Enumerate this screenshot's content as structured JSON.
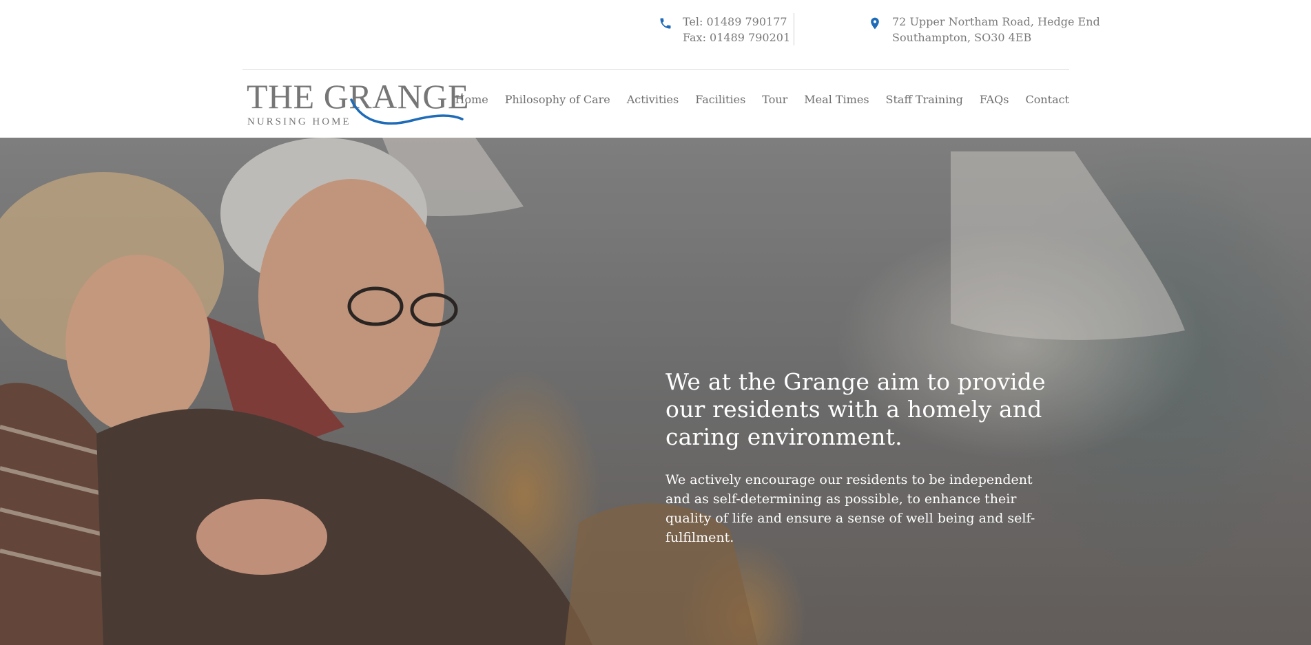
{
  "contact": {
    "phone_icon": "phone-icon",
    "tel": "Tel: 01489 790177",
    "fax": "Fax: 01489 790201",
    "location_icon": "map-marker-icon",
    "address_line1": "72 Upper Northam Road, Hedge End",
    "address_line2": "Southampton, SO30 4EB"
  },
  "logo": {
    "title": "THE GRANGE",
    "subtitle": "NURSING HOME"
  },
  "nav": {
    "items": [
      {
        "label": "Home"
      },
      {
        "label": "Philosophy of Care"
      },
      {
        "label": "Activities"
      },
      {
        "label": "Facilities"
      },
      {
        "label": "Tour"
      },
      {
        "label": "Meal Times"
      },
      {
        "label": "Staff Training"
      },
      {
        "label": "FAQs"
      },
      {
        "label": "Contact"
      }
    ]
  },
  "hero": {
    "heading": "We at the Grange aim to provide our residents with a homely and caring environment.",
    "body": "We actively encourage our residents to be independent and as self-determining as possible, to enhance their quality of life and ensure a sense of well being and self-fulfilment."
  },
  "colors": {
    "accent": "#1e6bb8",
    "text_grey": "#777777",
    "white": "#ffffff"
  }
}
